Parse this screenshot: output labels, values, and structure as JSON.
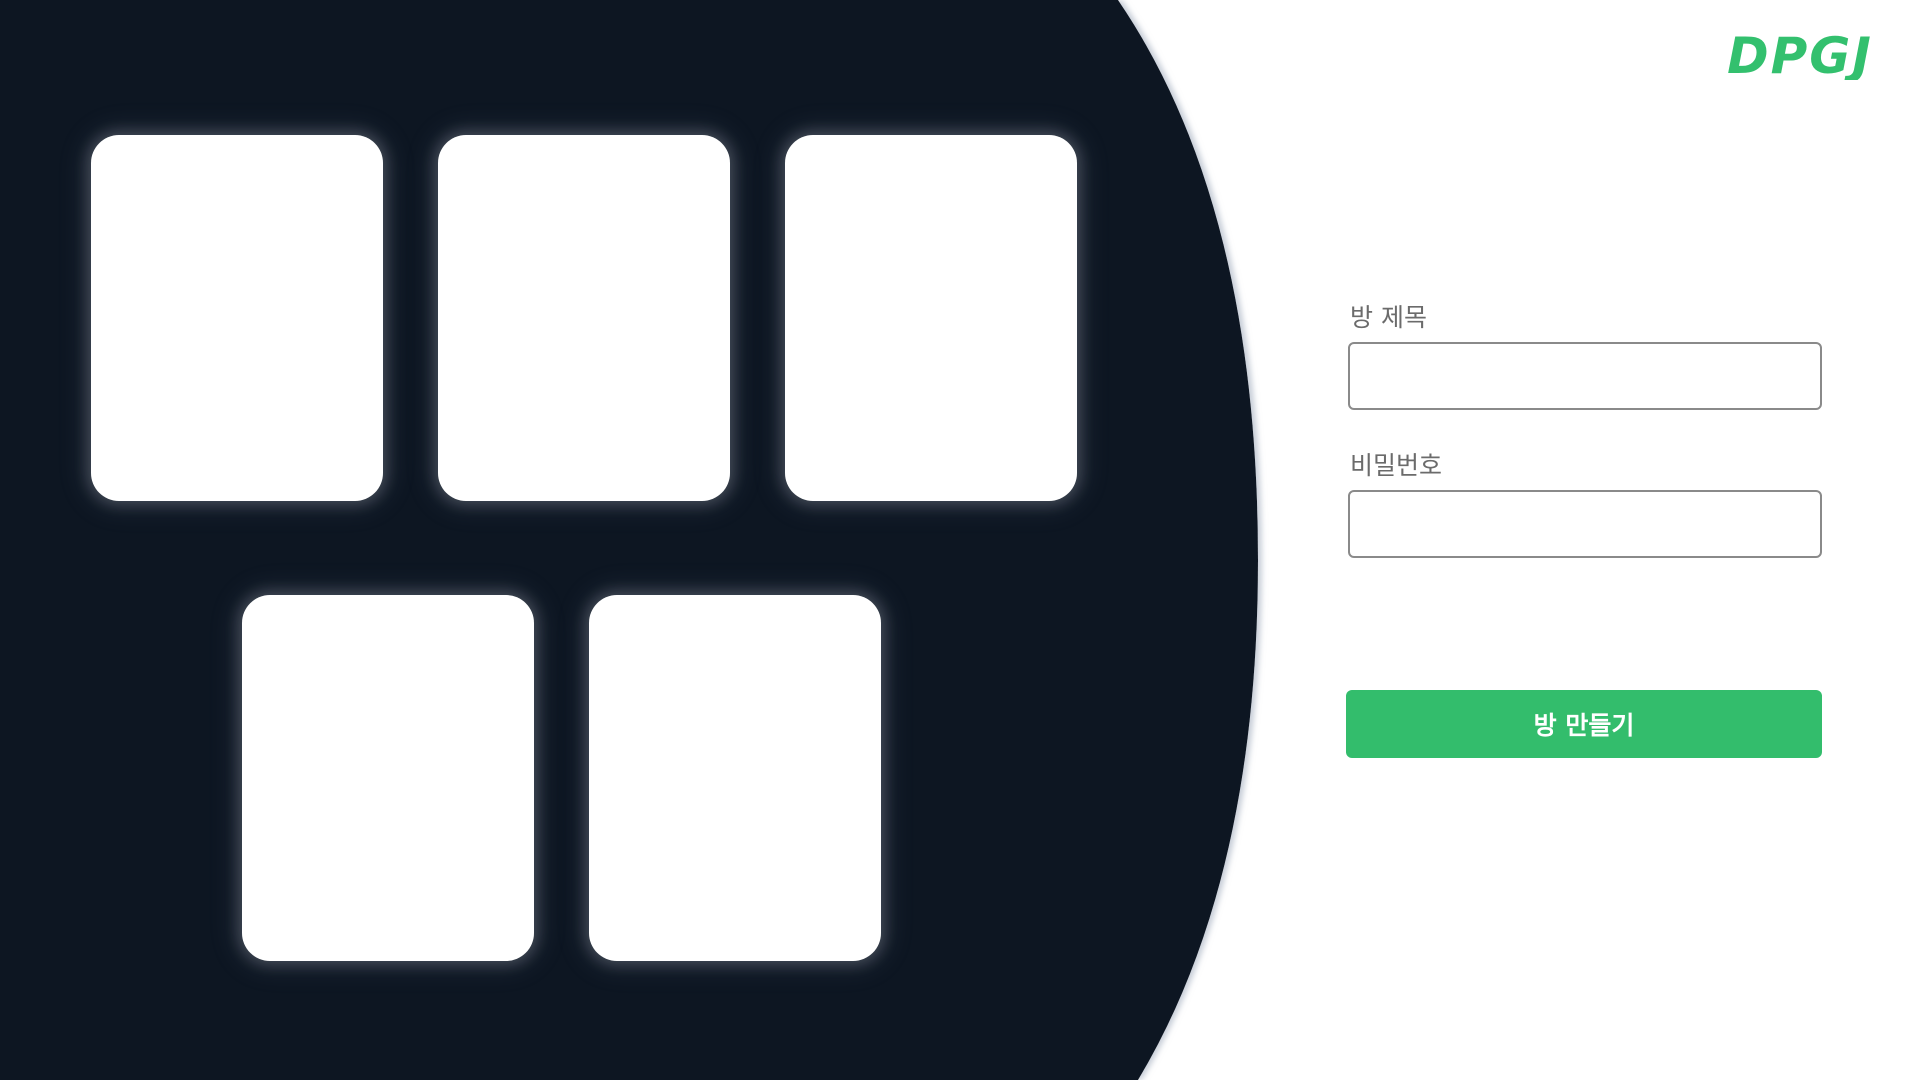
{
  "brand": {
    "logo_text": "DPGJ",
    "logo_color": "#33c06e"
  },
  "theme": {
    "dark_panel_color": "#101723",
    "card_color": "#ffffff",
    "accent_color": "#33bd6c"
  },
  "cards": [
    {
      "label": ""
    },
    {
      "label": ""
    },
    {
      "label": ""
    },
    {
      "label": ""
    },
    {
      "label": ""
    }
  ],
  "form": {
    "room_title_label": "방 제목",
    "room_title_value": "",
    "password_label": "비밀번호",
    "password_value": "",
    "create_button_label": "방 만들기"
  }
}
